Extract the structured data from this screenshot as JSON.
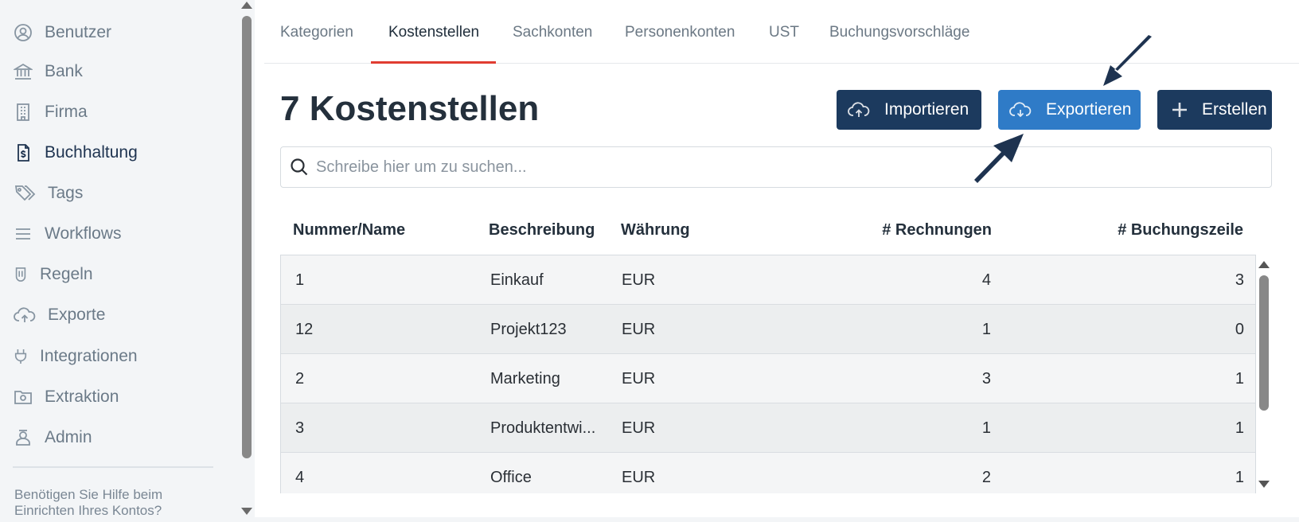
{
  "sidebar": {
    "items": [
      {
        "label": "Benutzer",
        "icon": "user-circle-icon"
      },
      {
        "label": "Bank",
        "icon": "bank-icon"
      },
      {
        "label": "Firma",
        "icon": "building-icon"
      },
      {
        "label": "Buchhaltung",
        "icon": "invoice-icon",
        "active": true
      },
      {
        "label": "Tags",
        "icon": "tags-icon"
      },
      {
        "label": "Workflows",
        "icon": "list-icon"
      },
      {
        "label": "Regeln",
        "icon": "rules-icon"
      },
      {
        "label": "Exporte",
        "icon": "cloud-upload-icon"
      },
      {
        "label": "Integrationen",
        "icon": "plug-icon"
      },
      {
        "label": "Extraktion",
        "icon": "folder-icon"
      },
      {
        "label": "Admin",
        "icon": "admin-icon"
      }
    ],
    "help_text": "Benötigen Sie Hilfe beim Einrichten Ihres Kontos?"
  },
  "tabs": [
    {
      "label": "Kategorien"
    },
    {
      "label": "Kostenstellen",
      "active": true
    },
    {
      "label": "Sachkonten"
    },
    {
      "label": "Personenkonten"
    },
    {
      "label": "UST"
    },
    {
      "label": "Buchungsvorschläge"
    }
  ],
  "main": {
    "title": "7 Kostenstellen",
    "buttons": {
      "import_label": "Importieren",
      "export_label": "Exportieren",
      "create_label": "Erstellen"
    },
    "search": {
      "placeholder": "Schreibe hier um zu suchen..."
    },
    "table": {
      "headers": [
        "Nummer/Name",
        "Beschreibung",
        "Währung",
        "# Rechnungen",
        "# Buchungszeile"
      ],
      "rows": [
        [
          "1",
          "Einkauf",
          "EUR",
          "4",
          "3"
        ],
        [
          "12",
          "Projekt123",
          "EUR",
          "1",
          "0"
        ],
        [
          "2",
          "Marketing",
          "EUR",
          "3",
          "1"
        ],
        [
          "3",
          "Produktentwi...",
          "EUR",
          "1",
          "1"
        ],
        [
          "4",
          "Office",
          "EUR",
          "2",
          "1"
        ]
      ]
    }
  },
  "colors": {
    "accent_dark": "#1c3a5e",
    "accent_blue": "#2f7bc7",
    "tab_underline": "#e03c31",
    "annotation_arrow": "#1e3350"
  }
}
